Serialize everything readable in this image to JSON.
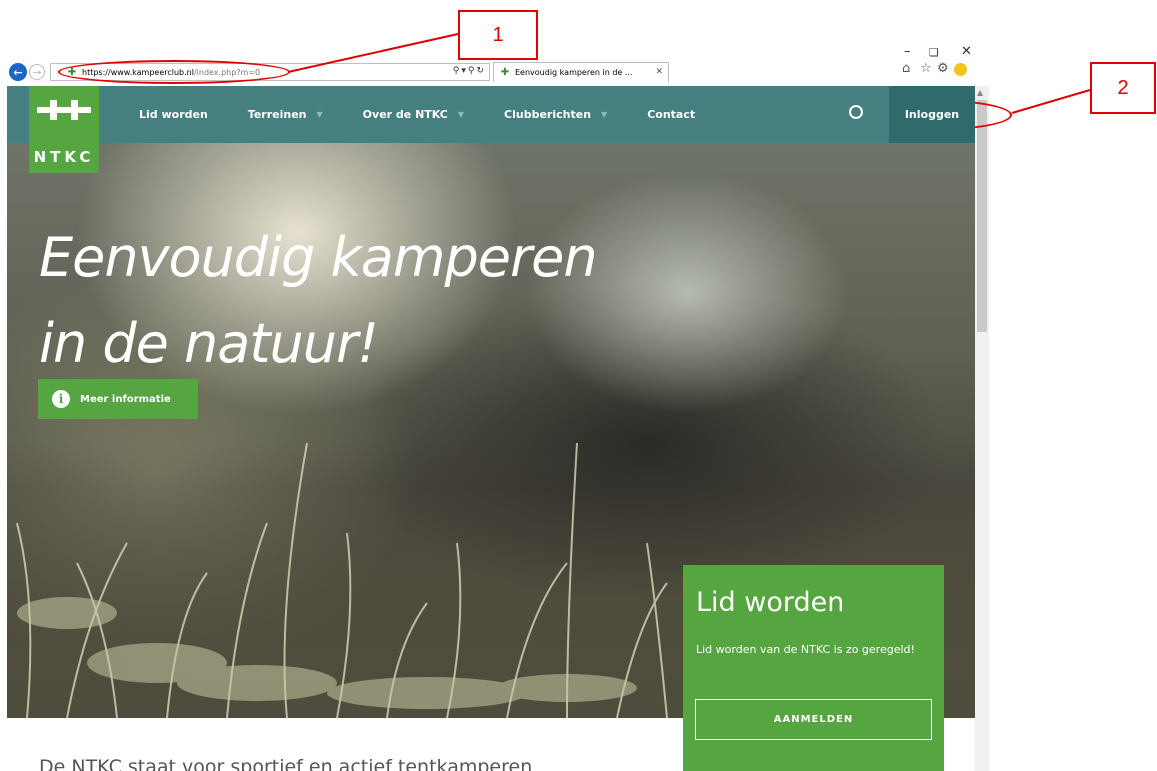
{
  "browser": {
    "url": {
      "protocol": "https://",
      "domain": "www.kampeerclub.nl",
      "path": "/index.php?m=0"
    },
    "tab_title": "Eenvoudig kamperen in de ...",
    "icons": [
      "back-arrow-icon",
      "forward-arrow-icon",
      "search-icon",
      "lock-icon",
      "refresh-icon",
      "home-icon",
      "star-icon",
      "gear-icon",
      "smiley-icon",
      "minimize-icon",
      "maximize-icon",
      "close-icon"
    ]
  },
  "annotations": {
    "label_1": "1",
    "label_2": "2",
    "color": "#e00000"
  },
  "site": {
    "logo_text": "NTKC",
    "nav": [
      {
        "label": "Lid worden",
        "has_dropdown": false
      },
      {
        "label": "Terreinen",
        "has_dropdown": true
      },
      {
        "label": "Over de NTKC",
        "has_dropdown": true
      },
      {
        "label": "Clubberichten",
        "has_dropdown": true
      },
      {
        "label": "Contact",
        "has_dropdown": false
      }
    ],
    "login_label": "Inloggen",
    "hero": {
      "title_line1": "Eenvoudig kamperen",
      "title_line2": "in de natuur!",
      "button_label": "Meer informatie"
    },
    "join_panel": {
      "title": "Lid worden",
      "text": "Lid worden van de NTKC is zo geregeld!",
      "button_label": "AANMELDEN"
    },
    "intro": "De NTKC staat voor sportief en actief tentkamperen"
  },
  "colors": {
    "header": "#467f80",
    "login_bg": "#2f6a6c",
    "brand_green": "#55a640"
  }
}
